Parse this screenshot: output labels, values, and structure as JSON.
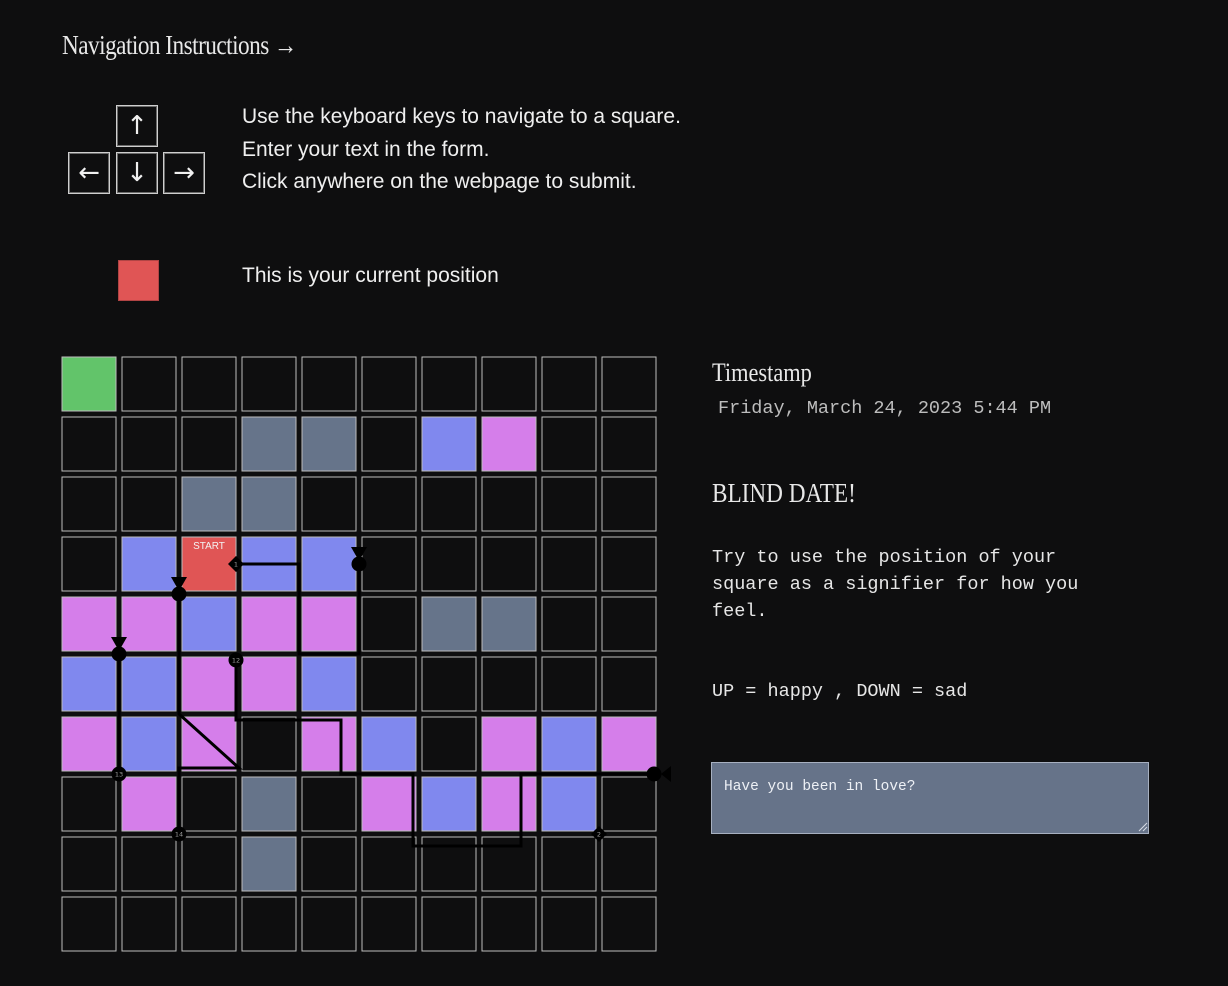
{
  "instructions": {
    "title": "Navigation Instructions →",
    "keys": {
      "up": "↑",
      "left": "←",
      "down": "↓",
      "right": "→"
    },
    "lines": [
      "Use the keyboard keys to navigate to a square.",
      "Enter your text in the form.",
      "Click anywhere on the webpage to submit."
    ],
    "position_label": "This is your current position"
  },
  "board": {
    "rows": 10,
    "cols": 10,
    "colors": {
      "empty": "#0e0e0f",
      "line": "#bdbdbd",
      "green": "#62c46a",
      "gray": "#66748a",
      "blue": "#8088ee",
      "pink": "#d57eea",
      "red": "#e05555",
      "path": "#000000"
    },
    "cells": [
      [
        "green",
        "empty",
        "empty",
        "empty",
        "empty",
        "empty",
        "empty",
        "empty",
        "empty",
        "empty"
      ],
      [
        "empty",
        "empty",
        "empty",
        "gray",
        "gray",
        "empty",
        "blue",
        "pink",
        "empty",
        "empty"
      ],
      [
        "empty",
        "empty",
        "gray",
        "gray",
        "empty",
        "empty",
        "empty",
        "empty",
        "empty",
        "empty"
      ],
      [
        "empty",
        "blue",
        "red",
        "blue",
        "blue",
        "empty",
        "empty",
        "empty",
        "empty",
        "empty"
      ],
      [
        "pink",
        "pink",
        "blue",
        "pink",
        "pink",
        "empty",
        "gray",
        "gray",
        "empty",
        "empty"
      ],
      [
        "blue",
        "blue",
        "pink",
        "pink",
        "blue",
        "empty",
        "empty",
        "empty",
        "empty",
        "empty"
      ],
      [
        "pink",
        "blue",
        "pink",
        "empty",
        "pink",
        "blue",
        "empty",
        "pink",
        "blue",
        "pink"
      ],
      [
        "empty",
        "pink",
        "empty",
        "gray",
        "empty",
        "pink",
        "blue",
        "pink",
        "blue",
        "empty"
      ],
      [
        "empty",
        "empty",
        "empty",
        "gray",
        "empty",
        "empty",
        "empty",
        "empty",
        "empty",
        "empty"
      ],
      [
        "empty",
        "empty",
        "empty",
        "empty",
        "empty",
        "empty",
        "empty",
        "empty",
        "empty",
        "empty"
      ]
    ],
    "start_label": "START",
    "start_cell": [
      3,
      2
    ],
    "paths": [
      {
        "name": "path-1",
        "points": [
          [
            3,
            2.45
          ],
          [
            3,
            3.5
          ],
          [
            4.5,
            3.5
          ],
          [
            4.5,
            4.5
          ],
          [
            3,
            4.5
          ]
        ],
        "start_marker": {
          "cell": [
            3,
            2.45
          ],
          "shape": "diamond",
          "label": "1"
        },
        "end_marker": {
          "cell": [
            3,
            4.5
          ],
          "shape": "triangle-down"
        }
      },
      {
        "name": "path-13",
        "points": [
          [
            4.5,
            0.5
          ],
          [
            6.5,
            0.5
          ]
        ],
        "start_marker": {
          "cell": [
            4.5,
            0.5
          ],
          "shape": "triangle-down"
        },
        "end_marker": {
          "cell": [
            6.5,
            0.5
          ],
          "shape": "circle",
          "label": "13"
        }
      },
      {
        "name": "path-14",
        "points": [
          [
            3.5,
            1.5
          ],
          [
            5.5,
            1.5
          ],
          [
            6.4,
            2.5
          ],
          [
            6.4,
            1.5
          ],
          [
            7.5,
            1.5
          ]
        ],
        "start_marker": {
          "cell": [
            3.5,
            1.5
          ],
          "shape": "triangle-down"
        },
        "end_marker": {
          "cell": [
            7.5,
            1.5
          ],
          "shape": "circle",
          "label": "14"
        }
      },
      {
        "name": "path-12",
        "points": [
          [
            4.6,
            2.45
          ],
          [
            5.6,
            2.45
          ],
          [
            5.6,
            4.2
          ],
          [
            6.5,
            4.2
          ],
          [
            6.5,
            5.4
          ],
          [
            7.7,
            5.4
          ],
          [
            7.7,
            7.2
          ],
          [
            6.5,
            7.2
          ],
          [
            6.5,
            8.5
          ],
          [
            6.5,
            9.5
          ]
        ],
        "start_marker": {
          "cell": [
            4.6,
            2.45
          ],
          "shape": "circle",
          "label": "12"
        },
        "end_marker": {
          "cell": [
            6.5,
            9.5
          ],
          "shape": "triangle-left"
        }
      },
      {
        "name": "path-2",
        "points": [
          [
            7.5,
            8.5
          ]
        ],
        "start_marker": {
          "cell": [
            7.5,
            8.5
          ],
          "shape": "diamond",
          "label": "2"
        },
        "end_marker": null
      }
    ]
  },
  "sidebar": {
    "timestamp_title": "Timestamp",
    "timestamp_value": "Friday, March 24, 2023 5:44 PM",
    "heading": "BLIND DATE!",
    "prompt": "Try to use the position of your square as a signifier for how you feel.",
    "legend": "UP = happy , DOWN = sad",
    "answer_text": "Have you been in love?"
  }
}
